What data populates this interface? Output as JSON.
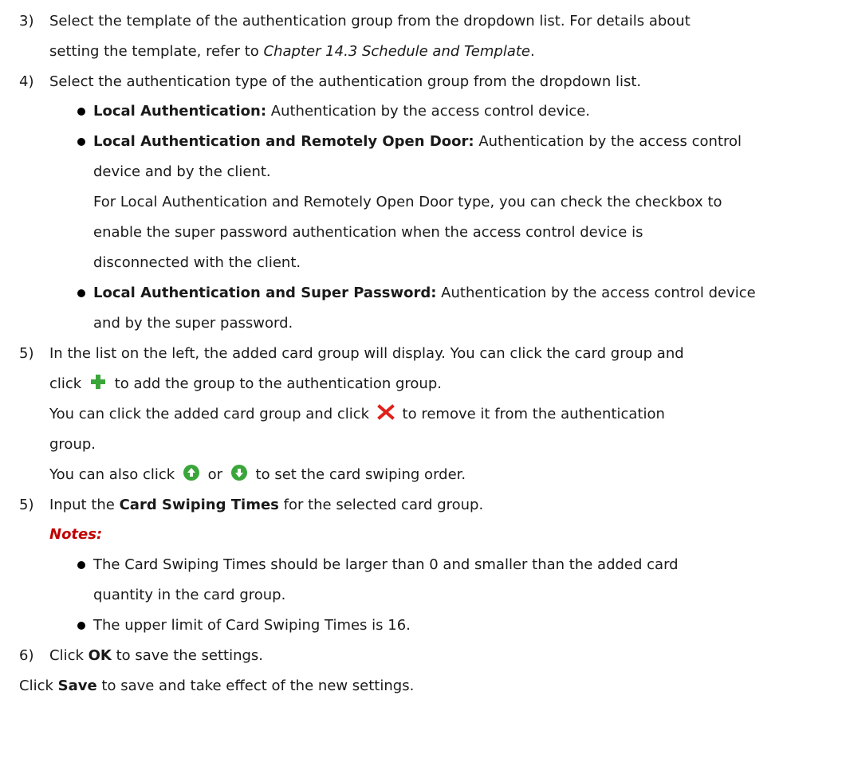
{
  "step3": {
    "num": "3)",
    "text_a": "Select the template of the authentication group from the dropdown list. For details about",
    "text_b1": "setting the template, refer to ",
    "ref": "Chapter 14.3 Schedule and Template",
    "text_b2": "."
  },
  "step4": {
    "num": "4)",
    "text": "Select the authentication type of the authentication group from the dropdown list.",
    "items": [
      {
        "label": "Local Authentication:",
        "text": " Authentication by the access control device."
      },
      {
        "label": "Local Authentication and Remotely Open Door:",
        "text": " Authentication by the access control",
        "cont": "device and by the client."
      },
      {
        "label": "Local Authentication and Super Password:",
        "text": " Authentication by the access control device",
        "cont": "and by the super password."
      }
    ],
    "note_lines": [
      "For Local Authentication and Remotely Open Door type, you can check the checkbox to",
      "enable the super password authentication when the access control device is",
      "disconnected with the client."
    ]
  },
  "step5a": {
    "num": "5)",
    "text_a": "In the list on the left, the added card group will display. You can click the card group and",
    "text_b1": "click",
    "text_b2": "to add the group to the authentication group.",
    "text_c1": "You can click the added card group and click",
    "text_c2": "to remove it from the authentication",
    "text_d": "group.",
    "text_e1": "You can also click",
    "text_e_or": "or",
    "text_e2": "to set the card swiping order.",
    "icons": [
      "add-icon",
      "remove-icon",
      "arrow-up-icon",
      "arrow-down-icon"
    ]
  },
  "step5b": {
    "num": "5)",
    "text1": "Input the ",
    "bold": "Card Swiping Times",
    "text2": " for the selected card group.",
    "notes_label": "Notes:",
    "bullets": [
      {
        "a": "The Card Swiping Times should be larger than 0 and smaller than the added card",
        "b": "quantity in the card group."
      },
      {
        "a": "The upper limit of Card Swiping Times is 16."
      }
    ]
  },
  "step6": {
    "num": "6)",
    "text1": "Click ",
    "bold": "OK",
    "text2": " to save the settings."
  },
  "final": {
    "text1": "Click ",
    "bold": "Save",
    "text2": " to save and take effect of the new settings."
  },
  "colors": {
    "notes": "#c00000",
    "add": "#3aa63a",
    "remove": "#e0211b",
    "arrows": "#3aa63a"
  }
}
